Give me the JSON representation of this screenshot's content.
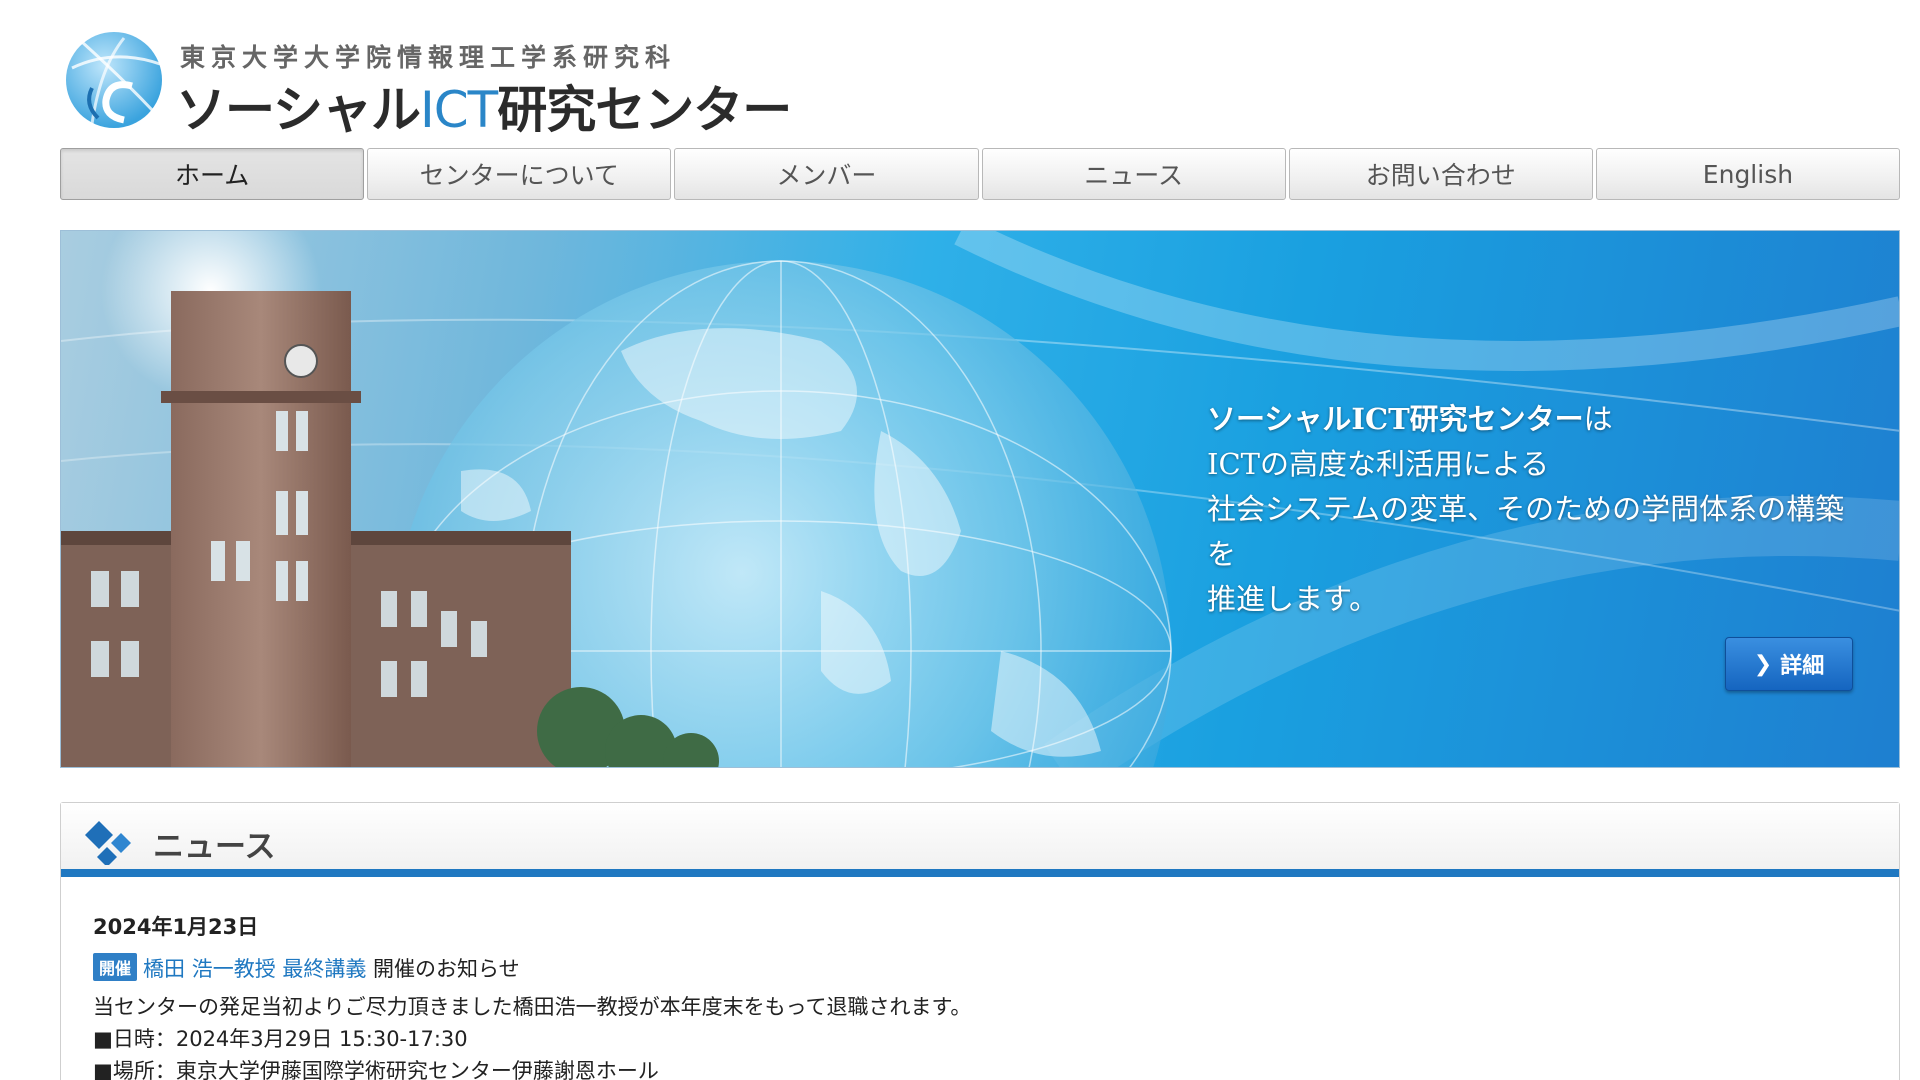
{
  "header": {
    "subtitle": "東京大学大学院情報理工学系研究科",
    "title_part1": "ソーシャル",
    "title_ict": "ICT",
    "title_part2": "研究センター"
  },
  "nav": {
    "items": [
      {
        "label": "ホーム",
        "active": true
      },
      {
        "label": "センターについて"
      },
      {
        "label": "メンバー"
      },
      {
        "label": "ニュース"
      },
      {
        "label": "お問い合わせ"
      },
      {
        "label": "English"
      }
    ]
  },
  "hero": {
    "line1_bold": "ソーシャルICT研究センター",
    "line1_rest": "は",
    "line2": "ICTの高度な利活用による",
    "line3": "社会システムの変革、そのための学問体系の構築",
    "line4": "を",
    "line5": "推進します。",
    "detail_button": "詳細",
    "detail_icon": "chevron-right-icon"
  },
  "news": {
    "title": "ニュース",
    "icon": "diamonds-icon",
    "accent_color": "#1f78c1",
    "items": [
      {
        "date": "2024年1月23日",
        "badge": "開催",
        "link_text": "橋田 浩一教授 最終講義",
        "title_rest": " 開催のお知らせ",
        "lines": [
          "当センターの発足当初よりご尽力頂きました橋田浩一教授が本年度末をもって退職されます。",
          "■日時：2024年3月29日 15:30-17:30",
          "■場所：東京大学伊藤国際学術研究センター伊藤謝恩ホール"
        ]
      }
    ]
  }
}
